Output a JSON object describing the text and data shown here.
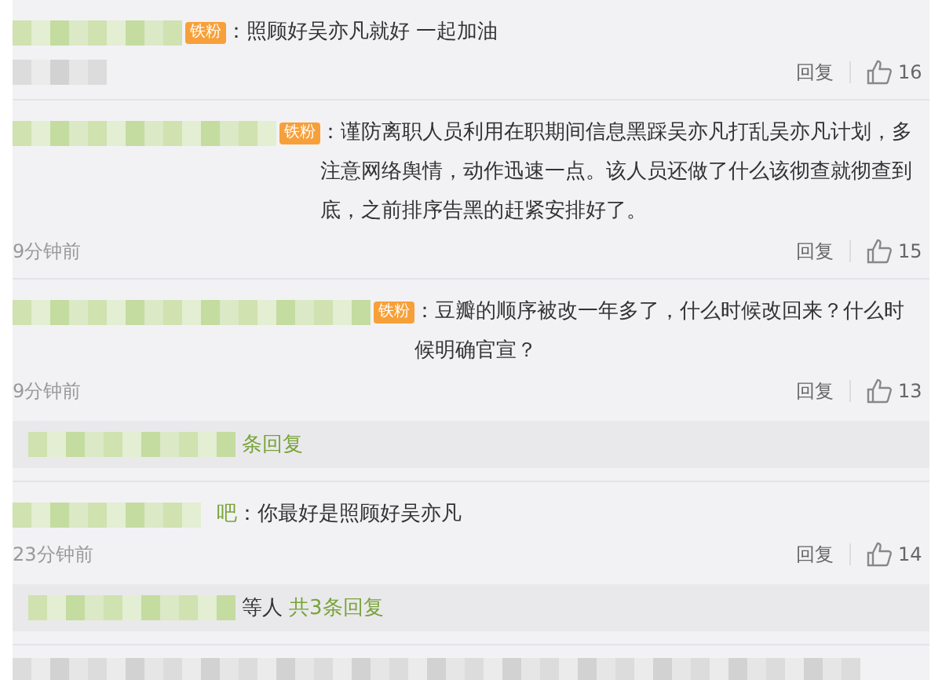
{
  "comments": [
    {
      "badge": "铁粉",
      "text": "：照顾好吴亦凡就好 一起加油",
      "reply": "回复",
      "likes": "16"
    },
    {
      "badge": "铁粉",
      "text": "：谨防离职人员利用在职期间信息黑踩吴亦凡打乱吴亦凡计划，多注意网络舆情，动作迅速一点。该人员还做了什么该彻查就彻查到底，之前排序告黑的赶紧安排好了。",
      "time": "9分钟前",
      "reply": "回复",
      "likes": "15"
    },
    {
      "badge": "铁粉",
      "text": "：豆瓣的顺序被改一年多了，什么时候改回来？什么时候明确官宣？",
      "time": "9分钟前",
      "reply": "回复",
      "likes": "13",
      "sub": {
        "link": "条回复"
      }
    },
    {
      "name_tail": "吧",
      "text": "：你最好是照顾好吴亦凡",
      "time": "23分钟前",
      "reply": "回复",
      "likes": "14",
      "sub": {
        "who": "等人",
        "link": "共3条回复"
      }
    }
  ]
}
